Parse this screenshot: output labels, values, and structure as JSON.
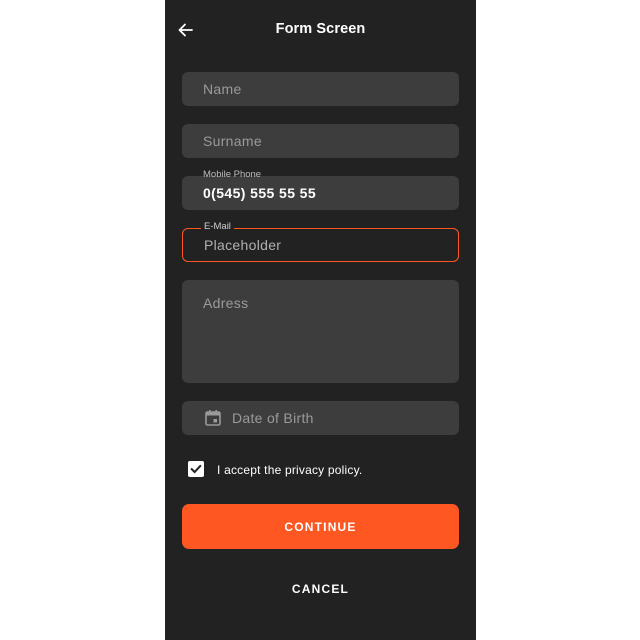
{
  "appbar": {
    "title": "Form Screen",
    "back_icon": "arrow-left-icon"
  },
  "form": {
    "name": {
      "placeholder": "Name"
    },
    "surname": {
      "placeholder": "Surname"
    },
    "mobile_phone": {
      "label": "Mobile Phone",
      "value": "0(545) 555 55 55"
    },
    "email": {
      "label": "E-Mail",
      "placeholder": "Placeholder"
    },
    "address": {
      "placeholder": "Adress"
    },
    "date_of_birth": {
      "placeholder": "Date of Birth",
      "icon": "calendar-icon"
    }
  },
  "privacy": {
    "label": "I accept the privacy policy.",
    "checked": true
  },
  "buttons": {
    "continue": "CONTINUE",
    "cancel": "CANCEL"
  },
  "colors": {
    "background": "#222222",
    "field": "#3d3d3d",
    "accent": "#ff5722",
    "text": "#ffffff"
  }
}
